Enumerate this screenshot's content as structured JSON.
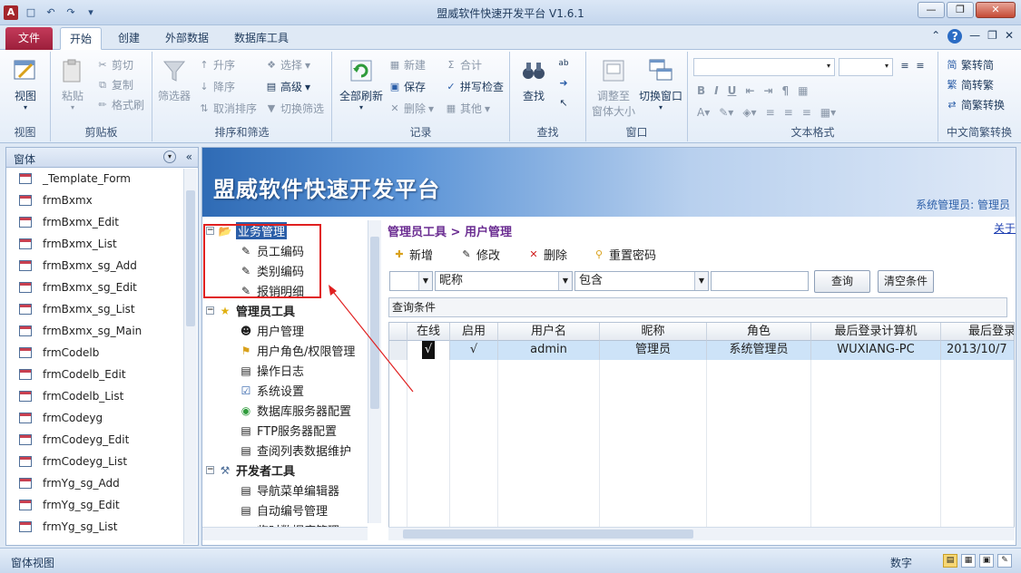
{
  "window": {
    "title": "盟威软件快速开发平台 V1.6.1"
  },
  "ribbon": {
    "tabs": [
      {
        "label": "文件"
      },
      {
        "label": "开始"
      },
      {
        "label": "创建"
      },
      {
        "label": "外部数据"
      },
      {
        "label": "数据库工具"
      }
    ],
    "groups": {
      "view": {
        "label": "视图",
        "view_button": "视图"
      },
      "clipboard": {
        "label": "剪贴板",
        "paste": "粘贴",
        "cut": "剪切",
        "copy": "复制",
        "format_painter": "格式刷"
      },
      "sort": {
        "label": "排序和筛选",
        "filter": "筛选器",
        "ascending": "升序",
        "descending": "降序",
        "clear_sort": "取消排序",
        "selection": "选择",
        "advanced": "高级",
        "toggle_filter": "切换筛选"
      },
      "records": {
        "label": "记录",
        "refresh_all": "全部刷新",
        "new": "新建",
        "save": "保存",
        "delete": "删除",
        "totals": "合计",
        "spelling": "拼写检查",
        "more": "其他"
      },
      "find": {
        "label": "查找",
        "find": "查找"
      },
      "window": {
        "label": "窗口",
        "size_to_fit": "调整至",
        "size_to_fit_2": "窗体大小",
        "switch": "切换窗口"
      },
      "text_format": {
        "label": "文本格式"
      },
      "chinese": {
        "label": "中文简繁转换",
        "to_simplified": "繁转简",
        "to_traditional": "简转繁",
        "conversion": "简繁转换"
      }
    }
  },
  "nav": {
    "header": "窗体",
    "items": [
      "_Template_Form",
      "frmBxmx",
      "frmBxmx_Edit",
      "frmBxmx_List",
      "frmBxmx_sg_Add",
      "frmBxmx_sg_Edit",
      "frmBxmx_sg_List",
      "frmBxmx_sg_Main",
      "frmCodelb",
      "frmCodelb_Edit",
      "frmCodelb_List",
      "frmCodeyg",
      "frmCodeyg_Edit",
      "frmCodeyg_List",
      "frmYg_sg_Add",
      "frmYg_sg_Edit",
      "frmYg_sg_List"
    ]
  },
  "banner": {
    "title": "盟威软件快速开发平台",
    "user": "系统管理员: 管理员"
  },
  "tree": {
    "business": {
      "label": "业务管理",
      "children": [
        "员工编码",
        "类别编码",
        "报销明细"
      ]
    },
    "admin": {
      "label": "管理员工具",
      "children": [
        "用户管理",
        "用户角色/权限管理",
        "操作日志",
        "系统设置",
        "数据库服务器配置",
        "FTP服务器配置",
        "查阅列表数据维护"
      ]
    },
    "dev": {
      "label": "开发者工具",
      "children": [
        "导航菜单编辑器",
        "自动编号管理",
        "临时数据库管理"
      ]
    }
  },
  "content": {
    "breadcrumb": "管理员工具 > 用户管理",
    "about": "关于",
    "toolbar": {
      "add": "新增",
      "edit": "修改",
      "delete": "删除",
      "reset_password": "重置密码"
    },
    "filter": {
      "field": "昵称",
      "op": "包含",
      "value": "",
      "query_button": "查询",
      "clear_button": "清空条件"
    },
    "query_conditions_label": "查询条件",
    "grid": {
      "columns": [
        "在线",
        "启用",
        "用户名",
        "昵称",
        "角色",
        "最后登录计算机",
        "最后登录"
      ],
      "rows": [
        {
          "online": "√",
          "enabled": "√",
          "username": "admin",
          "nickname": "管理员",
          "role": "系统管理员",
          "computer": "WUXIANG-PC",
          "last_login": "2013/10/7"
        }
      ]
    }
  },
  "statusbar": {
    "left": "窗体视图",
    "right": "数字"
  },
  "colors": {
    "accent": "#2b5ea8",
    "file_tab": "#a7213f",
    "highlight_box": "#e02020",
    "selected_row": "#cde3f8"
  }
}
